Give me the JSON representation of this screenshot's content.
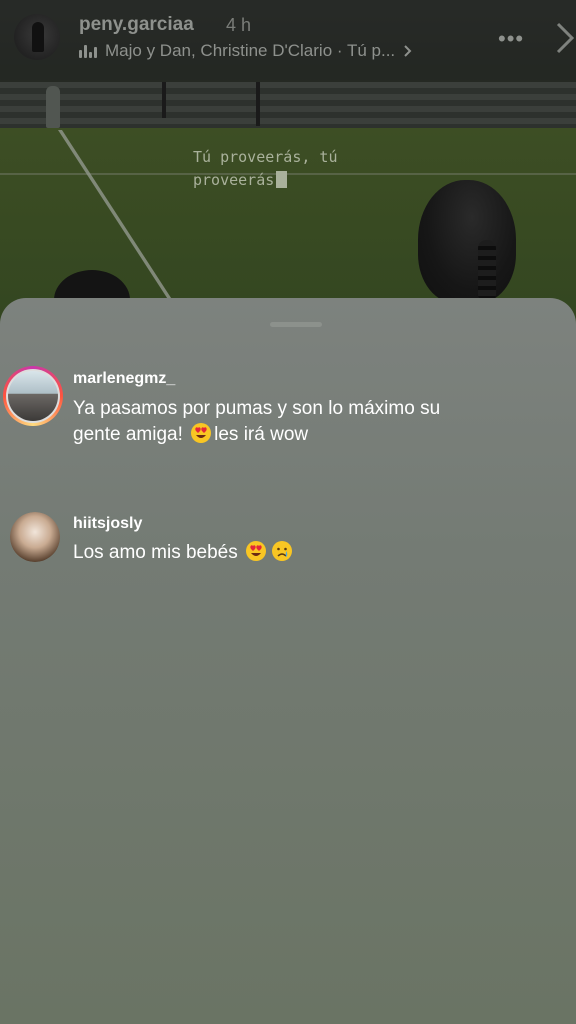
{
  "story": {
    "username": "peny.garciaa",
    "timestamp": "4 h",
    "music": "Majo y Dan, Christine D'Clario · Tú p...",
    "caption": "Tú proveerás, tú\nproveerás"
  },
  "comments": [
    {
      "username": "marlenegmz_",
      "text_line1": "Ya pasamos por pumas y son lo máximo su",
      "text_line2a": "gente amiga! ",
      "text_line2b": "les irá wow",
      "emojis": [
        "heart-eyes-emoji"
      ]
    },
    {
      "username": "hiitsjosly",
      "text": "Los amo mis bebés ",
      "emojis": [
        "heart-eyes-emoji",
        "crying-face-emoji"
      ]
    }
  ],
  "colors": {
    "sheet": "#747b74",
    "text": "#ffffff",
    "story_ring": "#c837ab"
  }
}
